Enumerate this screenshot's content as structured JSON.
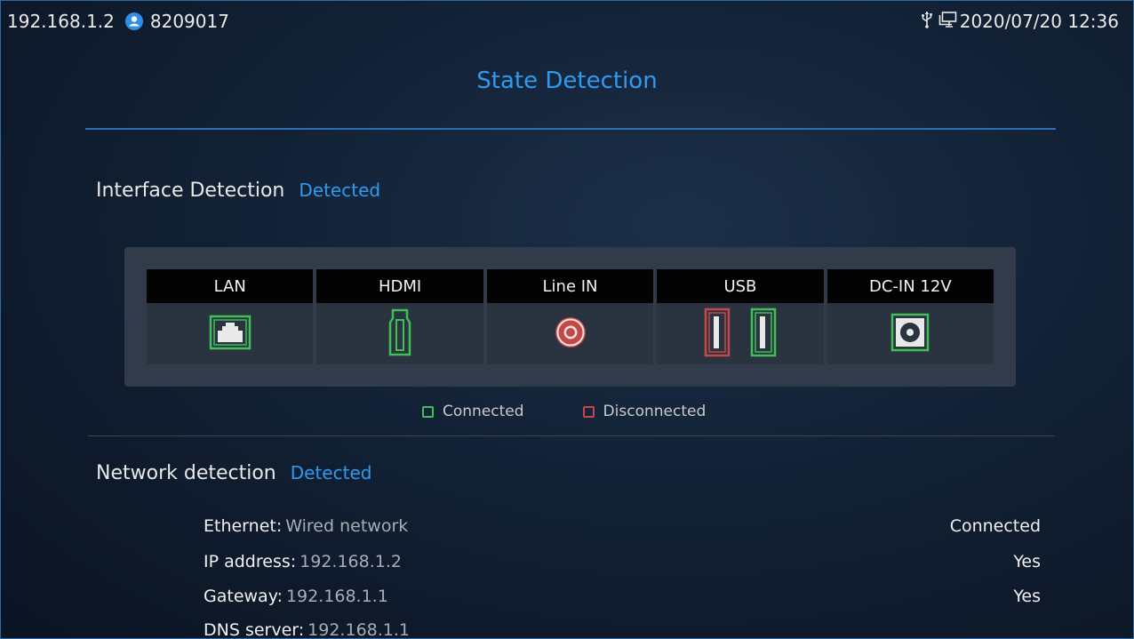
{
  "statusbar": {
    "ip": "192.168.1.2",
    "account": "8209017",
    "datetime": "2020/07/20 12:36"
  },
  "title": "State Detection",
  "interface": {
    "heading": "Interface Detection",
    "state": "Detected",
    "ports": [
      {
        "label": "LAN",
        "icon": "lan-port-icon",
        "status": "connected"
      },
      {
        "label": "HDMI",
        "icon": "hdmi-port-icon",
        "status": "connected"
      },
      {
        "label": "Line IN",
        "icon": "line-in-port-icon",
        "status": "disconnected"
      },
      {
        "label": "USB",
        "icon": "usb-port-icon",
        "status": "mixed"
      },
      {
        "label": "DC-IN 12V",
        "icon": "dc-in-port-icon",
        "status": "connected"
      }
    ],
    "legend": {
      "connected": "Connected",
      "disconnected": "Disconnected"
    }
  },
  "network": {
    "heading": "Network detection",
    "state": "Detected",
    "rows": [
      {
        "key": "Ethernet",
        "value": "Wired network",
        "status": "Connected"
      },
      {
        "key": "IP address",
        "value": "192.168.1.2",
        "status": "Yes"
      },
      {
        "key": "Gateway",
        "value": "192.168.1.1",
        "status": "Yes"
      },
      {
        "key": "DNS server",
        "value": "192.168.1.1",
        "status": ""
      }
    ]
  },
  "colors": {
    "accent": "#2e9bf0",
    "connected": "#3fbf55",
    "disconnected": "#c94646"
  }
}
